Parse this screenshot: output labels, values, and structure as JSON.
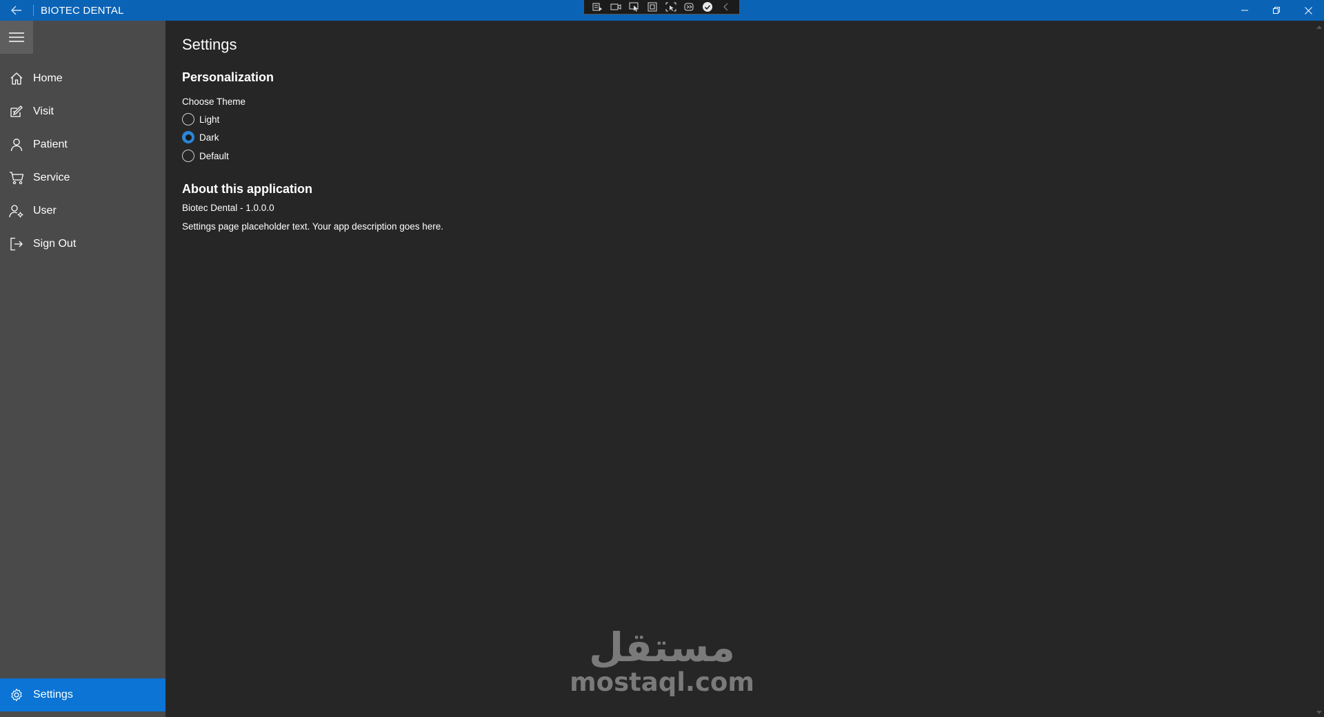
{
  "titlebar": {
    "app_title": "BIOTEC DENTAL"
  },
  "sidebar": {
    "items": [
      {
        "label": "Home",
        "icon": "home-icon"
      },
      {
        "label": "Visit",
        "icon": "edit-icon"
      },
      {
        "label": "Patient",
        "icon": "person-icon"
      },
      {
        "label": "Service",
        "icon": "cart-icon"
      },
      {
        "label": "User",
        "icon": "user-settings-icon"
      },
      {
        "label": "Sign Out",
        "icon": "sign-out-icon"
      }
    ],
    "settings": {
      "label": "Settings",
      "icon": "gear-icon"
    }
  },
  "main": {
    "title": "Settings",
    "personalization": {
      "heading": "Personalization",
      "choose_theme": "Choose Theme",
      "options": [
        {
          "label": "Light",
          "checked": false
        },
        {
          "label": "Dark",
          "checked": true
        },
        {
          "label": "Default",
          "checked": false
        }
      ]
    },
    "about": {
      "heading": "About this application",
      "version": "Biotec Dental - 1.0.0.0",
      "description": "Settings page placeholder text.  Your app description goes here."
    }
  },
  "watermark": {
    "arabic": "مستقل",
    "latin": "mostaql.com"
  },
  "colors": {
    "titlebar": "#0b63b6",
    "sidebar": "#4a4a4a",
    "selected": "#0b74d4",
    "background": "#262626",
    "radio_accent": "#2a86d8"
  }
}
